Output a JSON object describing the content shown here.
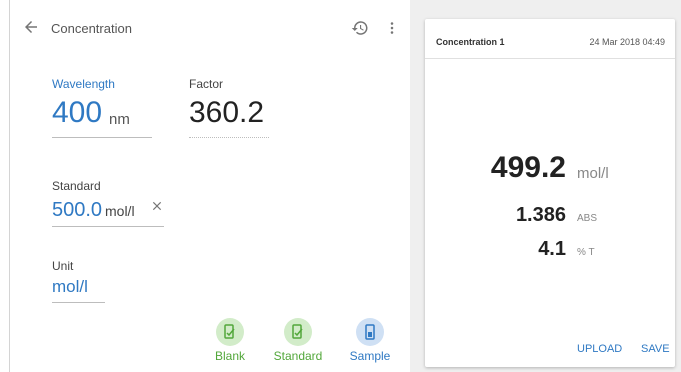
{
  "header": {
    "title": "Concentration",
    "icons": [
      "back-arrow-icon",
      "history-icon",
      "more-vert-icon"
    ]
  },
  "wavelength": {
    "label": "Wavelength",
    "value": "400",
    "unit": "nm"
  },
  "factor": {
    "label": "Factor",
    "value": "360.2"
  },
  "standard": {
    "label": "Standard",
    "value": "500.0",
    "unit": "mol/l"
  },
  "unit": {
    "label": "Unit",
    "value": "mol/l"
  },
  "actions": {
    "blank": "Blank",
    "standard": "Standard",
    "sample": "Sample"
  },
  "result_card": {
    "title": "Concentration 1",
    "date": "24 Mar 2018 04:49",
    "concentration": {
      "value": "499.2",
      "unit": "mol/l"
    },
    "absorbance": {
      "value": "1.386",
      "unit": "ABS"
    },
    "transmittance": {
      "value": "4.1",
      "unit": "% T"
    },
    "upload_label": "UPLOAD",
    "save_label": "SAVE"
  },
  "colors": {
    "accent": "#2f79c3",
    "green": "#52a73a",
    "green_bg": "#d2ecc9",
    "blue_bg": "#cfe0f4",
    "panel_bg": "#efefef"
  }
}
